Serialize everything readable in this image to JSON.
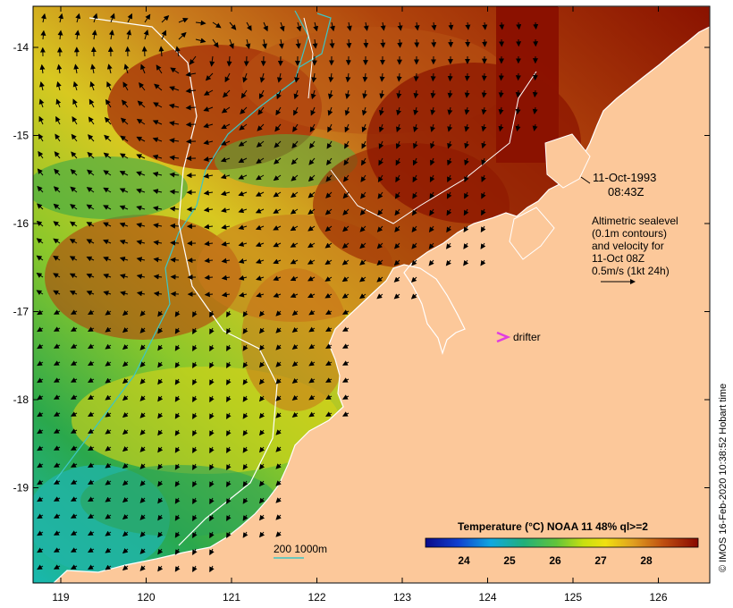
{
  "map": {
    "lon_ticks": [
      "119",
      "120",
      "121",
      "122",
      "123",
      "124",
      "125",
      "126"
    ],
    "lat_ticks": [
      "-14",
      "-15",
      "-16",
      "-17",
      "-18",
      "-19"
    ]
  },
  "annotations": {
    "date": "11-Oct-1993",
    "time": "08:43Z",
    "altimetry_lines": [
      "Altimetric sealevel",
      "(0.1m contours)",
      "and velocity for",
      "11-Oct 08Z",
      "0.5m/s (1kt 24h)"
    ],
    "drifter_label": "drifter",
    "isobath_label": "200  1000m"
  },
  "colorbar": {
    "title": "Temperature (°C) NOAA 11 48% ql>=2",
    "ticks": [
      "24",
      "25",
      "26",
      "27",
      "28"
    ]
  },
  "credit": "© IMOS 16-Feb-2020 10:38:52 Hobart time",
  "colors": {
    "land": "#fcc89a",
    "sst_warm": "#8b0a00",
    "sst_mid": "#e4e00a",
    "sst_cool": "#29a84c",
    "drifter": "#e03de0",
    "isobath_200": "#3cc6c6",
    "isobath_1000": "#ffffff"
  }
}
